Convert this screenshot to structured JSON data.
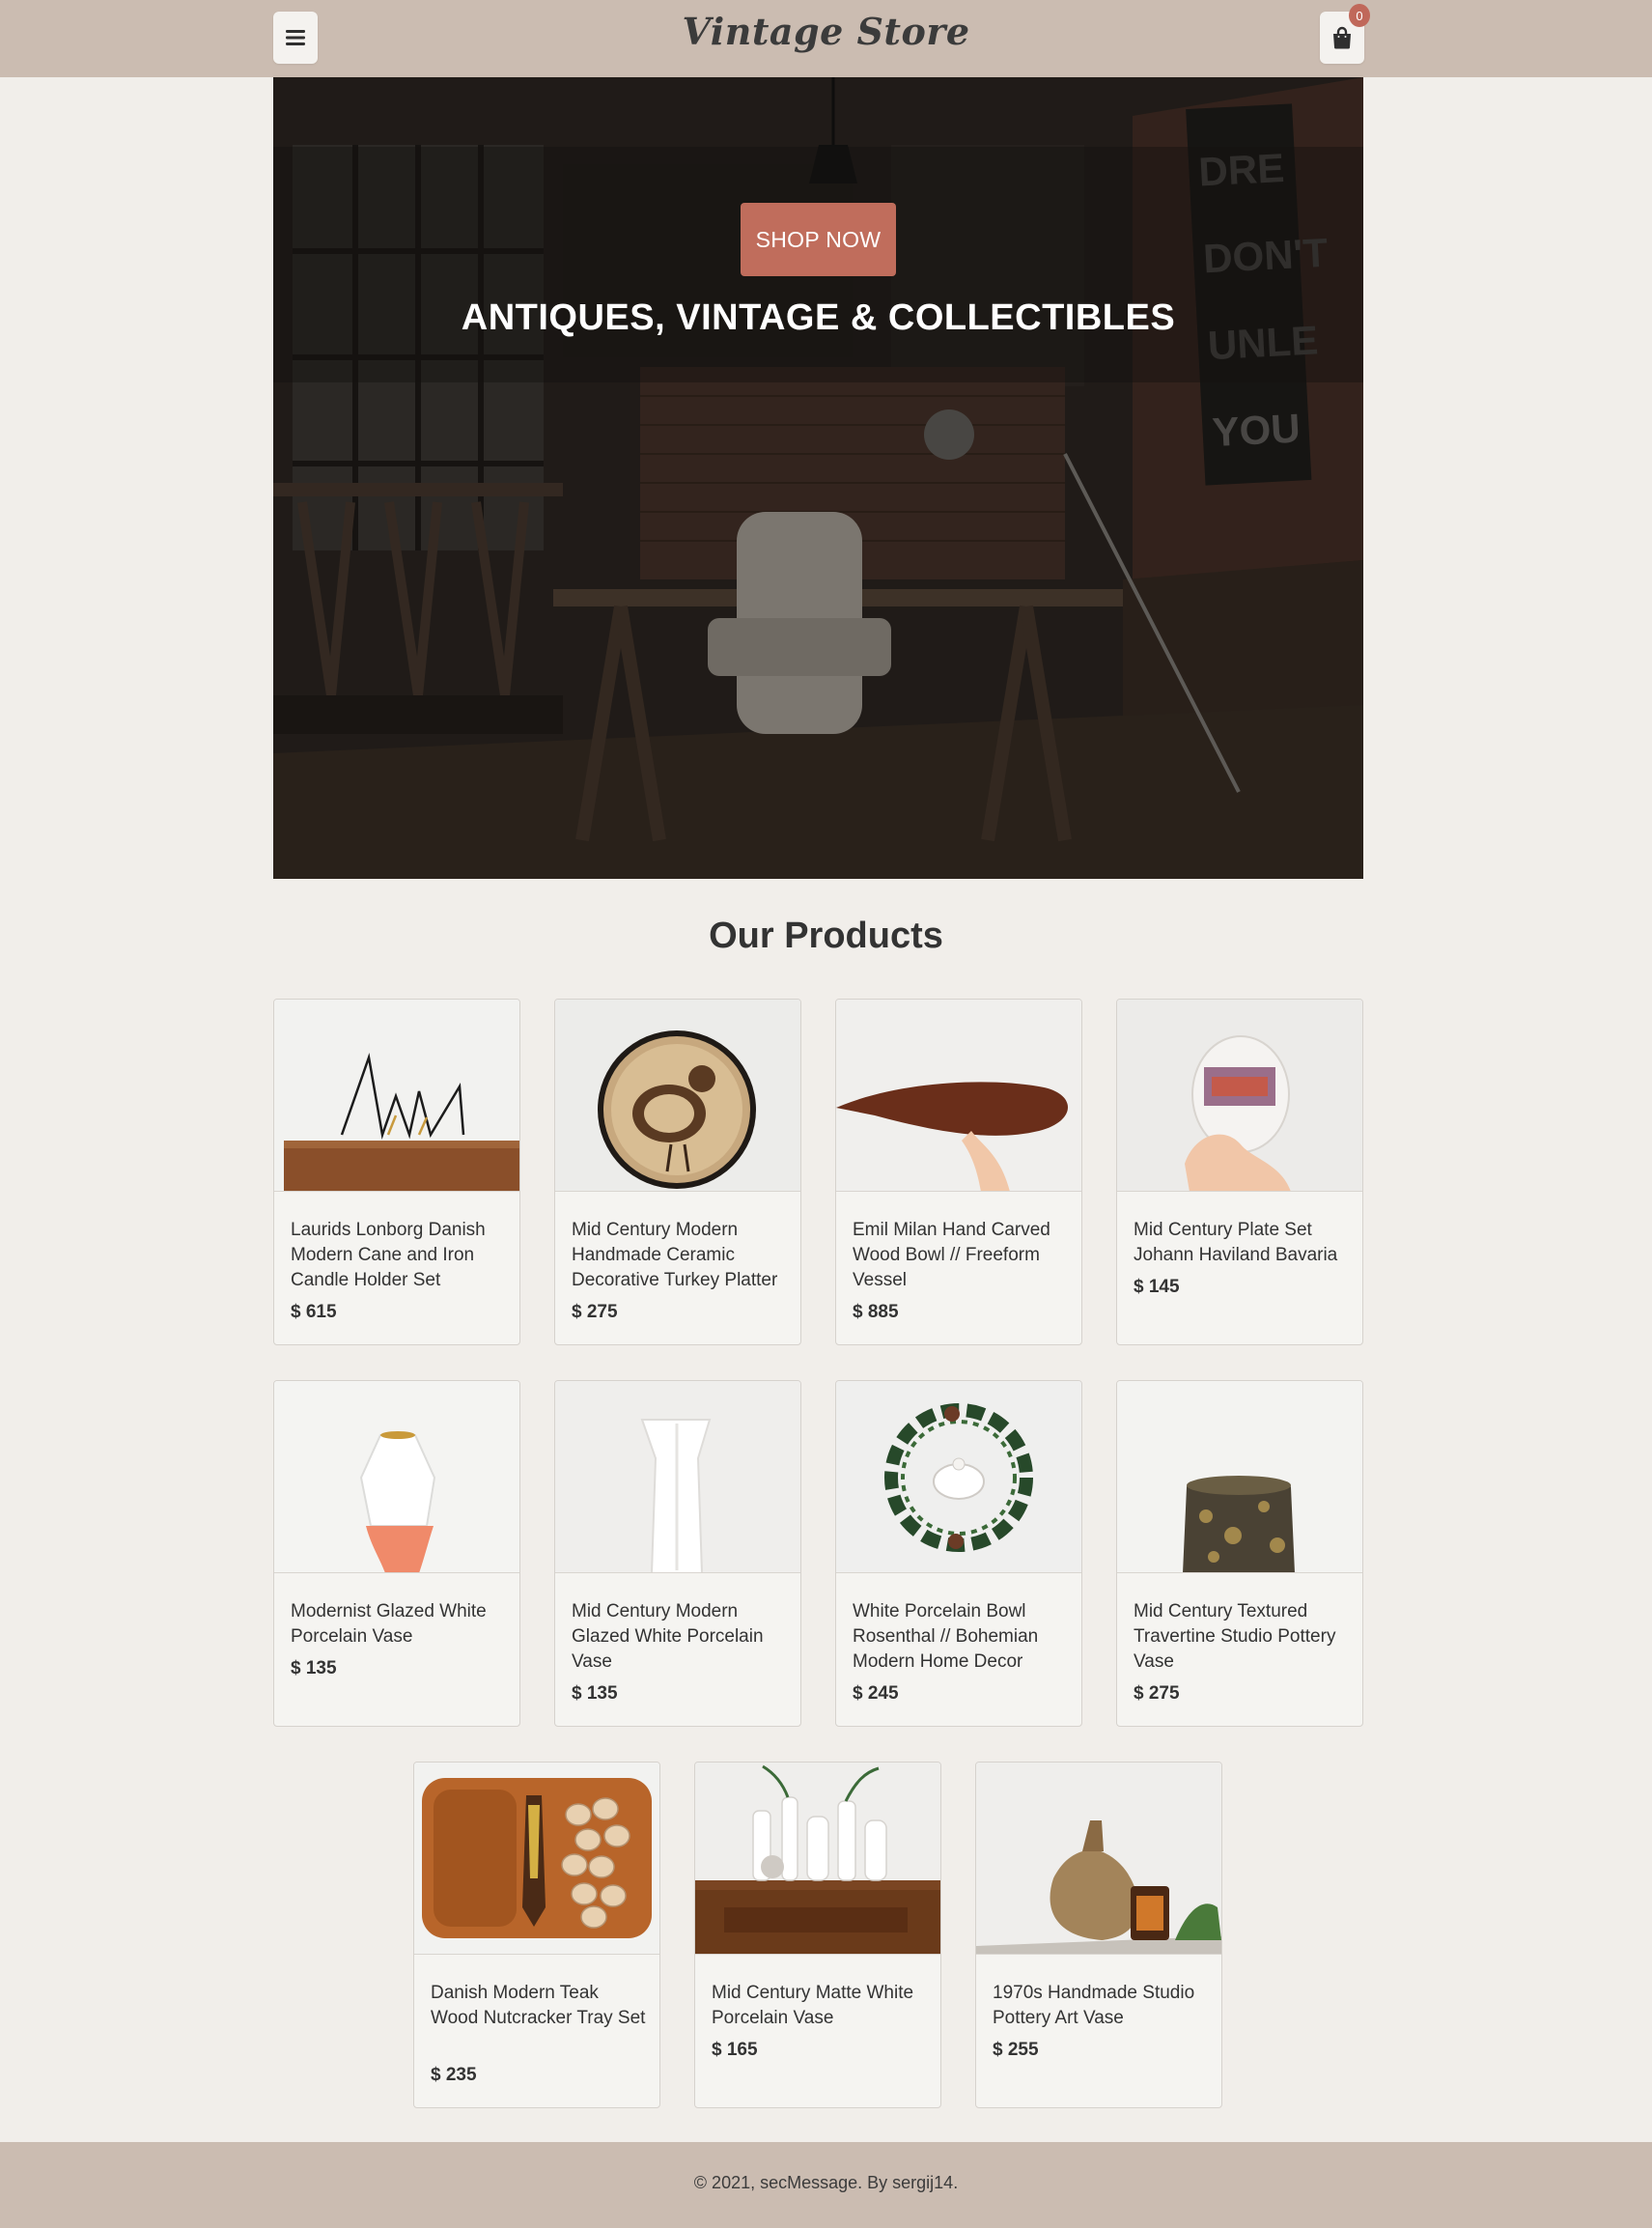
{
  "header": {
    "logo": "Vintage Store",
    "menu_icon": "hamburger-icon",
    "cart_icon": "shopping-bag-icon",
    "cart_count": "0"
  },
  "hero": {
    "cta_label": "SHOP NOW",
    "title": "ANTIQUES, VINTAGE & COLLECTIBLES"
  },
  "products_section": {
    "title": "Our Products",
    "items": [
      {
        "name": "Laurids Lonborg Danish Modern Cane and Iron Candle Holder Set",
        "price": "$ 615"
      },
      {
        "name": "Mid Century Modern Handmade Ceramic Decorative Turkey Platter",
        "price": "$ 275"
      },
      {
        "name": "Emil Milan Hand Carved Wood Bowl // Freeform Vessel",
        "price": "$ 885"
      },
      {
        "name": "Mid Century Plate Set Johann Haviland Bavaria",
        "price": "$ 145"
      },
      {
        "name": "Modernist Glazed White Porcelain Vase",
        "price": "$ 135"
      },
      {
        "name": "Mid Century Modern Glazed White Porcelain Vase",
        "price": "$ 135"
      },
      {
        "name": "White Porcelain Bowl Rosenthal // Bohemian Modern Home Decor",
        "price": "$ 245"
      },
      {
        "name": "Mid Century Textured Travertine Studio Pottery Vase",
        "price": "$ 275"
      },
      {
        "name": "Danish Modern Teak Wood Nutcracker Tray Set",
        "price": "$ 235"
      },
      {
        "name": "Mid Century Matte White Porcelain Vase",
        "price": "$ 165"
      },
      {
        "name": "1970s Handmade Studio Pottery Art Vase",
        "price": "$ 255"
      }
    ]
  },
  "footer": {
    "text": "© 2021, secMessage. By sergij14."
  },
  "colors": {
    "header_bg": "#cbbcb1",
    "page_bg": "#f1eeea",
    "accent": "#c06d5c",
    "badge": "#c0685a"
  }
}
